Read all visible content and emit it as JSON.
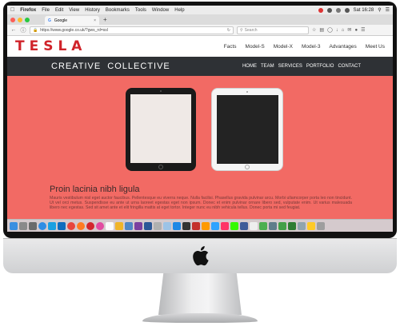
{
  "menubar": {
    "app_name": "Firefox",
    "items": [
      "File",
      "Edit",
      "View",
      "History",
      "Bookmarks",
      "Tools",
      "Window",
      "Help"
    ],
    "clock": "Sat 16:28"
  },
  "browser": {
    "tab_title": "Google",
    "url": "https://www.google.co.uk/?gws_rd=ssl",
    "search_placeholder": "Search"
  },
  "tesla": {
    "logo": "TESLA",
    "nav": [
      "Facts",
      "Model-S",
      "Model-X",
      "Model-3",
      "Advantages",
      "Meet Us"
    ]
  },
  "site": {
    "title": "CREATIVE  COLLECTIVE",
    "nav": [
      "HOME",
      "TEAM",
      "SERVICES",
      "PORTFOLIO",
      "CONTACT"
    ]
  },
  "content": {
    "heading": "Proin lacinia nibh ligula",
    "paragraph": "Mauris vestibulum nisl eget auctor faucibus. Pellentesque eu viverra neque. Nulla facilisi. Phasellus gravida pulvinar arcu. Morbi ullamcorper porta leo non tincidunt. Ut vel orci metus. Suspendisse eu ante ut urna laoreet egestas eget non ipsum. Donec et enim pulvinar ornare libero sed, vulputate enim. Ut varius malesuada libero nec egestas. Sed sit amet ante et elit fringilla mattis at eget tortor. Integer nunc eu nibh vehicula tellus. Donec porta mi sed feugiat."
  },
  "colors": {
    "page_background": "#f26a64",
    "tesla_red": "#d0232a",
    "nav_bar": "#2e3135"
  },
  "dock": {
    "icons": [
      "finder-icon",
      "launchpad-icon",
      "settings-icon",
      "safari-icon",
      "skype-icon",
      "edge-icon",
      "chrome-icon",
      "firefox-icon",
      "opera-icon",
      "itunes-icon",
      "calendar-icon",
      "photos-icon",
      "mail-icon",
      "onenote-icon",
      "word-icon",
      "folder-icon",
      "preview-icon",
      "quicktime-icon",
      "terminal-icon",
      "acrobat-icon",
      "illustrator-icon",
      "photoshop-icon",
      "indesign-icon",
      "dreamweaver-icon",
      "app-icon",
      "textedit-icon",
      "maps-icon",
      "camera-icon",
      "money-icon",
      "update-icon",
      "archive-icon",
      "notes-icon",
      "trash-icon"
    ]
  }
}
